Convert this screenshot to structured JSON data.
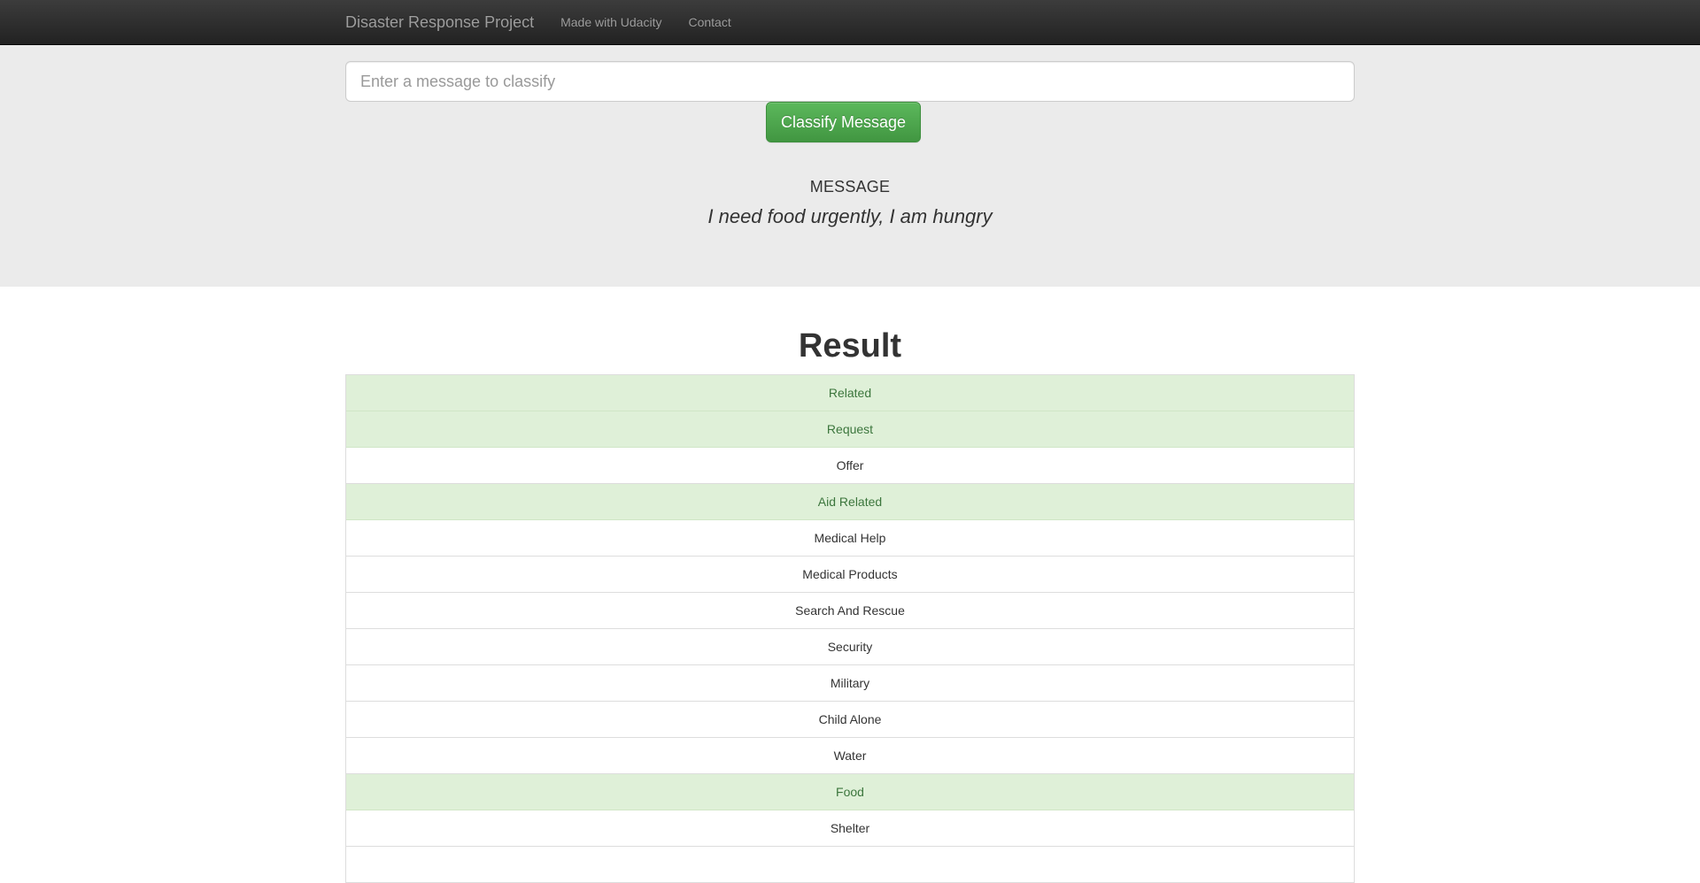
{
  "navbar": {
    "brand": "Disaster Response Project",
    "links": [
      {
        "label": "Made with Udacity"
      },
      {
        "label": "Contact"
      }
    ]
  },
  "search": {
    "placeholder": "Enter a message to classify",
    "value": "",
    "button_label": "Classify Message"
  },
  "message": {
    "heading": "MESSAGE",
    "text": "I need food urgently, I am hungry"
  },
  "result": {
    "title": "Result",
    "categories": [
      {
        "label": "Related",
        "positive": true
      },
      {
        "label": "Request",
        "positive": true
      },
      {
        "label": "Offer",
        "positive": false
      },
      {
        "label": "Aid Related",
        "positive": true
      },
      {
        "label": "Medical Help",
        "positive": false
      },
      {
        "label": "Medical Products",
        "positive": false
      },
      {
        "label": "Search And Rescue",
        "positive": false
      },
      {
        "label": "Security",
        "positive": false
      },
      {
        "label": "Military",
        "positive": false
      },
      {
        "label": "Child Alone",
        "positive": false
      },
      {
        "label": "Water",
        "positive": false
      },
      {
        "label": "Food",
        "positive": true
      },
      {
        "label": "Shelter",
        "positive": false
      },
      {
        "label": "",
        "positive": false
      }
    ]
  },
  "colors": {
    "navbar_bg": "#222222",
    "jumbotron_bg": "#ebebeb",
    "button_green": "#5cb85c",
    "positive_bg": "#dff0d8",
    "positive_text": "#3c763d"
  }
}
